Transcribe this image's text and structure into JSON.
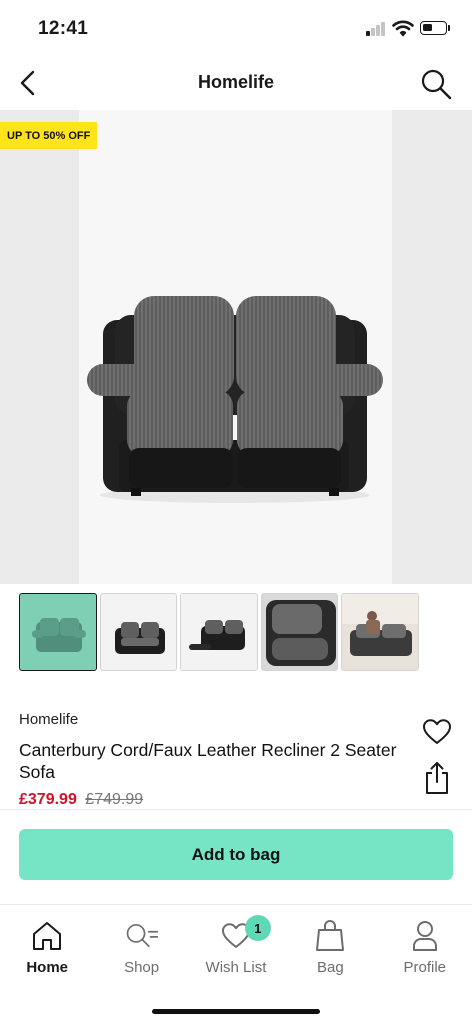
{
  "status_bar": {
    "time": "12:41",
    "signal_bars_active": 1,
    "icons": [
      "signal-icon",
      "wifi-icon",
      "battery-icon"
    ]
  },
  "header": {
    "title": "Homelife",
    "back_icon": "chevron-left-icon",
    "search_icon": "search-icon"
  },
  "product": {
    "promo_badge": "UP TO 50% OFF",
    "brand": "Homelife",
    "name": "Canterbury Cord/Faux Leather Recliner 2 Seater Sofa",
    "price_now": "£379.99",
    "price_was": "£749.99",
    "thumbnails_count": 5,
    "selected_thumbnail": 1
  },
  "actions": {
    "add_to_bag": "Add to bag",
    "wishlist_icon": "heart-icon",
    "share_icon": "share-icon"
  },
  "bottom_nav": {
    "items": [
      {
        "label": "Home",
        "icon": "home-icon",
        "active": true
      },
      {
        "label": "Shop",
        "icon": "shop-search-icon",
        "active": false
      },
      {
        "label": "Wish List",
        "icon": "heart-icon",
        "active": false,
        "badge": "1"
      },
      {
        "label": "Bag",
        "icon": "bag-icon",
        "active": false
      },
      {
        "label": "Profile",
        "icon": "profile-icon",
        "active": false
      }
    ]
  },
  "colors": {
    "accent": "#76e5c5",
    "badge_yellow": "#ffe419",
    "sale_red": "#d0122b"
  }
}
